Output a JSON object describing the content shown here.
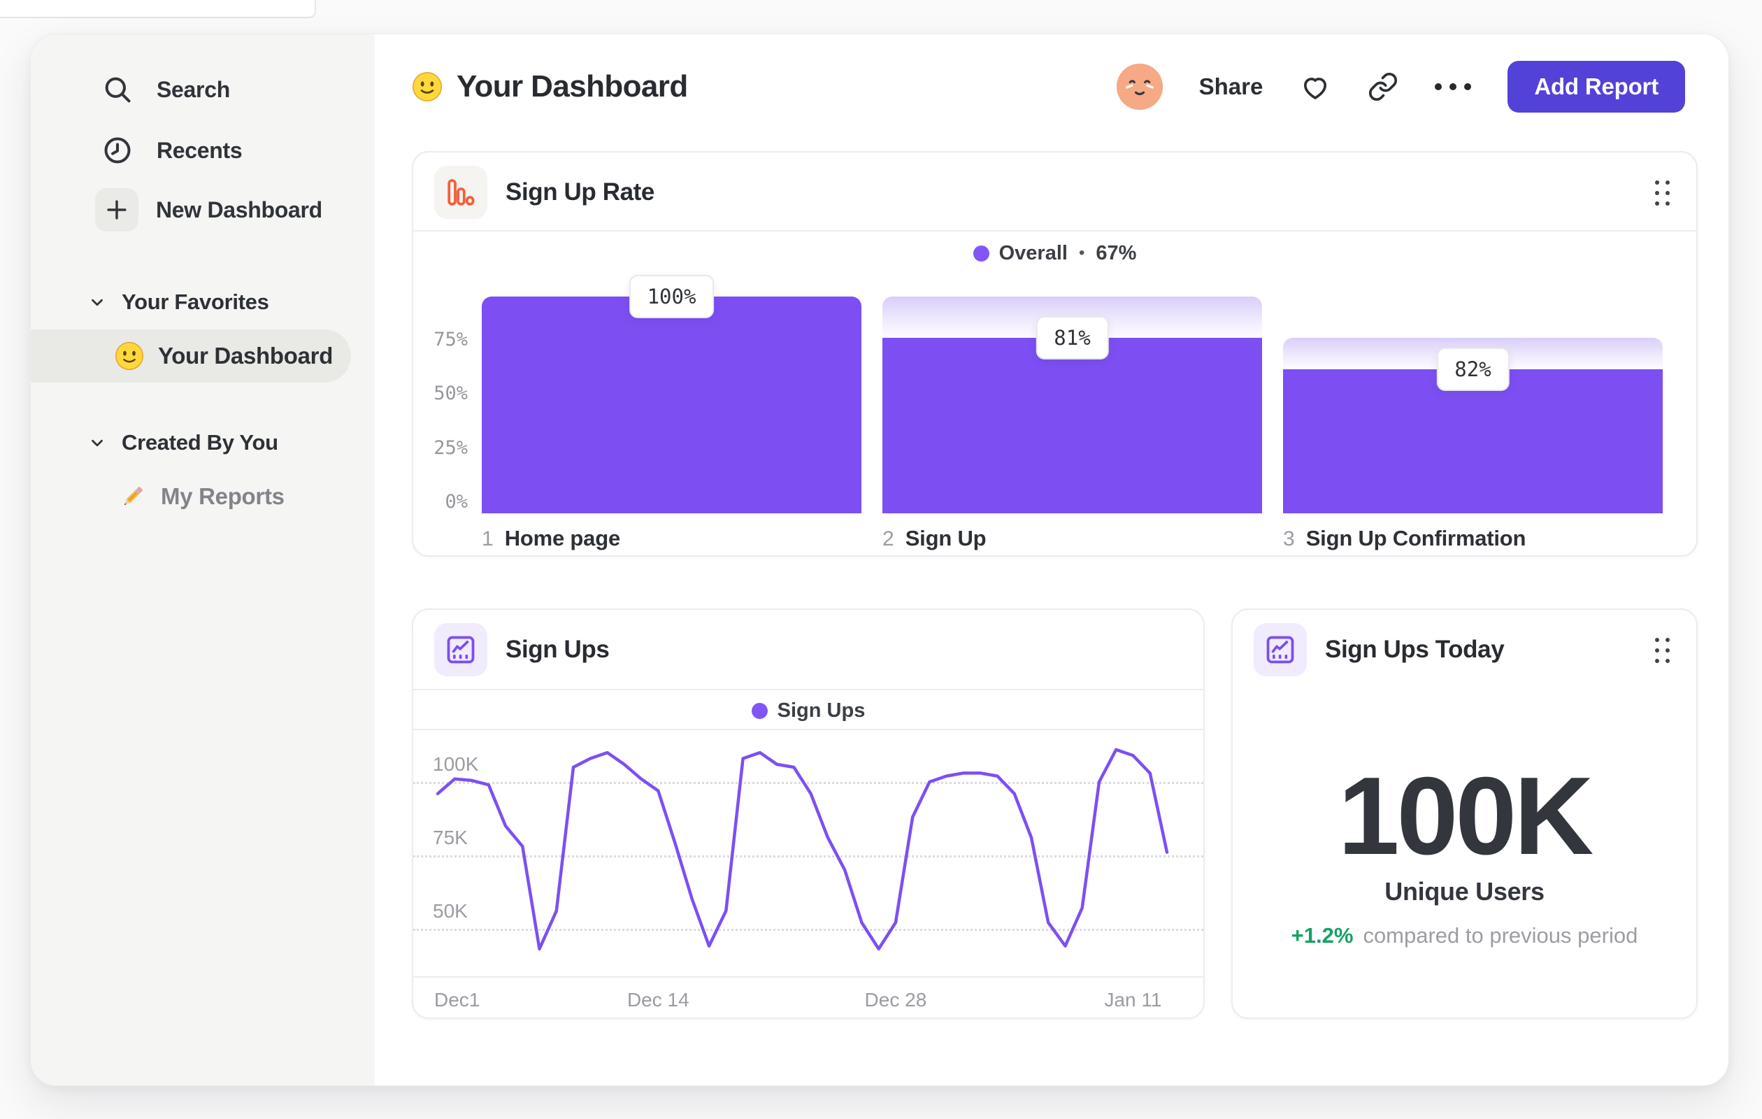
{
  "sidebar": {
    "nav": [
      {
        "icon": "search-icon",
        "label": "Search"
      },
      {
        "icon": "clock-icon",
        "label": "Recents"
      },
      {
        "icon": "plus-icon",
        "label": "New Dashboard"
      }
    ],
    "sections": [
      {
        "title": "Your Favorites",
        "items": [
          {
            "icon": "smiley-emoji",
            "label": "Your Dashboard",
            "active": true
          }
        ]
      },
      {
        "title": "Created By You",
        "items": [
          {
            "icon": "pencil-emoji",
            "label": "My Reports",
            "active": false
          }
        ]
      }
    ]
  },
  "header": {
    "title_icon": "smiley-emoji",
    "title": "Your Dashboard",
    "actions": {
      "share": "Share",
      "add_report": "Add Report"
    }
  },
  "colors": {
    "accent_purple": "#7d4ff2",
    "legend_dot": "#8256f5",
    "button_indigo": "#5242d8",
    "icon_orange": "#f2603c",
    "positive_green": "#16a163"
  },
  "chart_data": [
    {
      "type": "bar",
      "subtype": "funnel",
      "title": "Sign Up Rate",
      "legend": {
        "series": "Overall",
        "separator": "•",
        "value": "67%"
      },
      "categories": [
        "Home page",
        "Sign Up",
        "Sign Up Confirmation"
      ],
      "step_numbers": [
        "1",
        "2",
        "3"
      ],
      "values": [
        100,
        81,
        82
      ],
      "value_labels": [
        "100%",
        "81%",
        "82%"
      ],
      "bar_total_pct": [
        100,
        100,
        81
      ],
      "bar_solid_pct": [
        100,
        81,
        66.4
      ],
      "yticks": [
        {
          "value": 0,
          "label": "0%"
        },
        {
          "value": 25,
          "label": "25%"
        },
        {
          "value": 50,
          "label": "50%"
        },
        {
          "value": 75,
          "label": "75%"
        }
      ],
      "ylim": [
        0,
        100
      ],
      "overall_conversion": "67%"
    },
    {
      "type": "line",
      "title": "Sign Ups",
      "legend": "Sign Ups",
      "x_description": "days since Dec 1, daily points",
      "values_unit": "thousands of sign ups",
      "values": [
        96,
        101,
        100.5,
        99,
        85,
        78,
        43,
        56,
        105,
        108,
        110,
        106,
        101,
        97,
        79,
        60,
        44,
        56,
        108,
        110,
        106,
        105,
        96,
        81,
        70,
        52,
        43,
        52,
        88,
        100,
        102,
        103,
        103,
        102,
        96,
        81,
        52,
        44,
        57,
        100,
        111,
        109,
        103,
        76
      ],
      "xticks": [
        {
          "x": 0,
          "label": "Dec1"
        },
        {
          "x": 13,
          "label": "Dec 14"
        },
        {
          "x": 27,
          "label": "Dec 28"
        },
        {
          "x": 41,
          "label": "Jan 11"
        }
      ],
      "yticks": [
        {
          "value": 100,
          "label": "100K"
        },
        {
          "value": 75,
          "label": "75K"
        },
        {
          "value": 50,
          "label": "50K"
        }
      ],
      "ylim": [
        38,
        116
      ],
      "grid": "horizontal dotted"
    },
    {
      "type": "single_value",
      "title": "Sign Ups Today",
      "value": "100K",
      "value_label": "Unique Users",
      "delta": "+1.2%",
      "delta_note": "compared to previous period"
    }
  ]
}
